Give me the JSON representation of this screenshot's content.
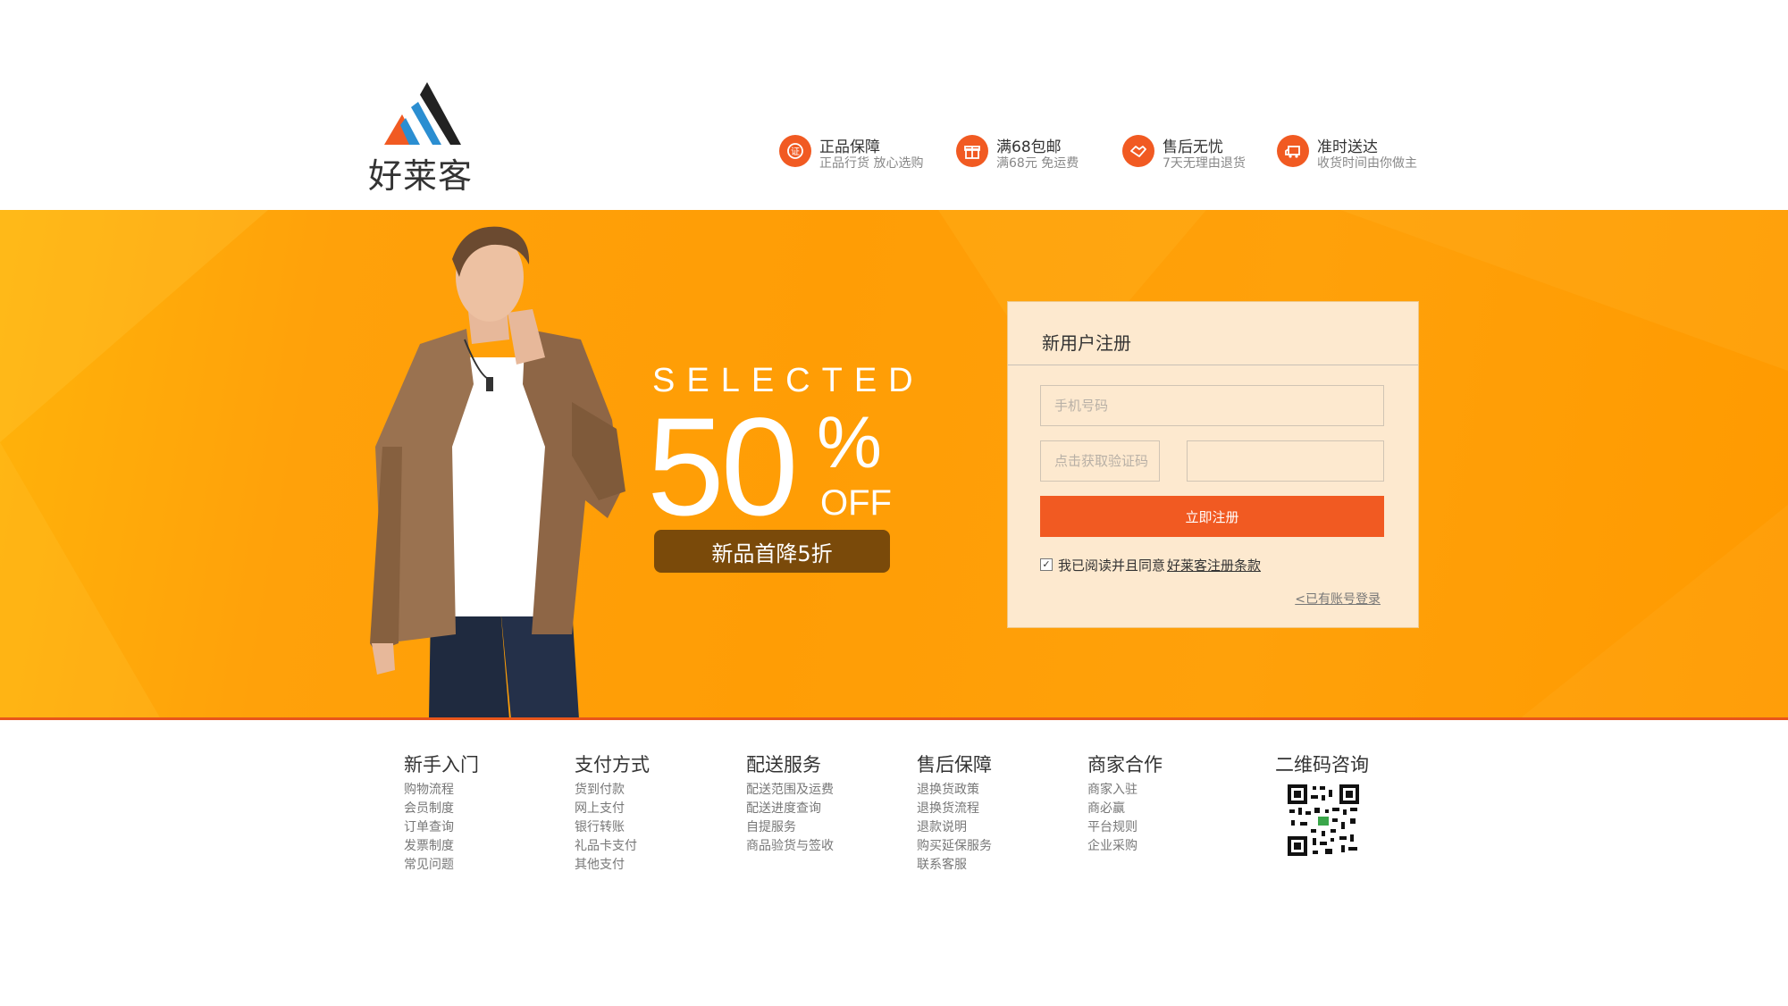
{
  "brand": {
    "name": "好莱客",
    "logo_colors": [
      "#f15a22",
      "#2b8ed1",
      "#222222"
    ]
  },
  "features": [
    {
      "icon": "certificate-icon",
      "title": "正品保障",
      "subtitle": "正品行货  放心选购"
    },
    {
      "icon": "gift-icon",
      "title": "满68包邮",
      "subtitle": "满68元  免运费"
    },
    {
      "icon": "handshake-icon",
      "title": "售后无忧",
      "subtitle": "7天无理由退货"
    },
    {
      "icon": "truck-icon",
      "title": "准时送达",
      "subtitle": "收货时间由你做主"
    }
  ],
  "promo": {
    "selected": "SELECTED",
    "number": "50",
    "percent": "%",
    "off": "OFF",
    "tag": "新品首降5折"
  },
  "register": {
    "title": "新用户注册",
    "phone_placeholder": "手机号码",
    "code_placeholder": "点击获取验证码",
    "code_value": "",
    "submit_label": "立即注册",
    "agree_text": "我已阅读并且同意",
    "agree_link": "好莱客注册条款",
    "agree_checked": true,
    "login_link": "<已有账号登录"
  },
  "footer": {
    "columns": [
      {
        "title": "新手入门",
        "links": [
          "购物流程",
          "会员制度",
          "订单查询",
          "发票制度",
          "常见问题"
        ]
      },
      {
        "title": "支付方式",
        "links": [
          "货到付款",
          "网上支付",
          "银行转账",
          "礼品卡支付",
          "其他支付"
        ]
      },
      {
        "title": "配送服务",
        "links": [
          "配送范围及运费",
          "配送进度查询",
          "自提服务",
          "商品验货与签收"
        ]
      },
      {
        "title": "售后保障",
        "links": [
          "退换货政策",
          "退换货流程",
          "退款说明",
          "购买延保服务",
          "联系客服"
        ]
      },
      {
        "title": "商家合作",
        "links": [
          "商家入驻",
          "商必赢",
          "平台规则",
          "企业采购"
        ]
      }
    ],
    "qr_title": "二维码咨询"
  },
  "colors": {
    "accent": "#f15a22",
    "banner": "#ffa10a",
    "panel": "#fde9cf",
    "tag": "#7a4a0a"
  }
}
